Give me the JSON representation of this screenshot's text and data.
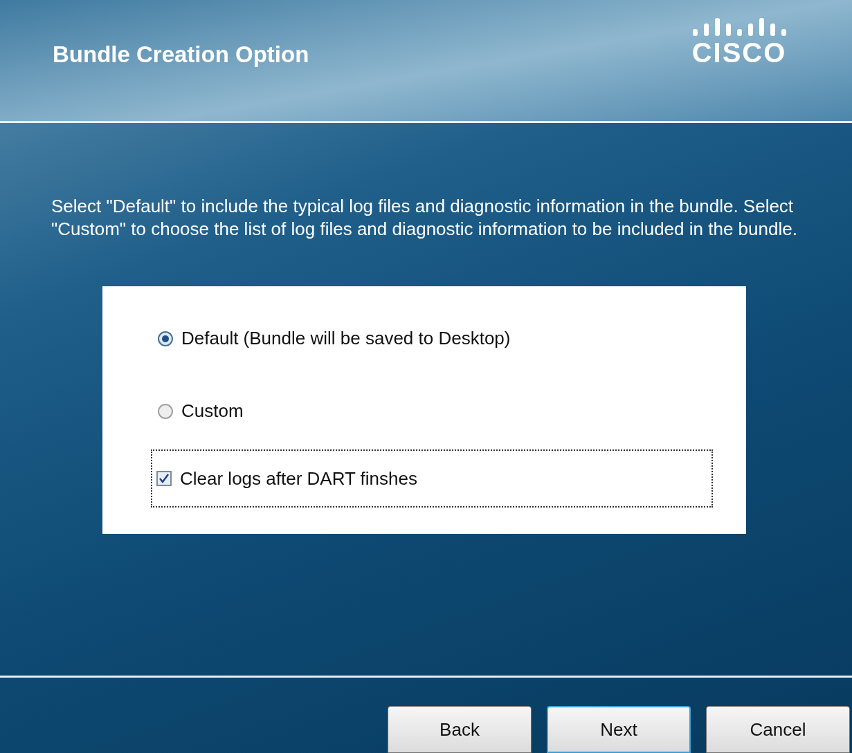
{
  "header": {
    "title": "Bundle Creation Option",
    "logo_text": "CISCO"
  },
  "description": "Select \"Default\" to include the typical log files and diagnostic information in the bundle.  Select \"Custom\" to choose the list of log files and diagnostic information to be included in the bundle.",
  "options": [
    {
      "label": "Default (Bundle will be saved to Desktop)",
      "selected": true
    },
    {
      "label": "Custom",
      "selected": false
    }
  ],
  "checkbox": {
    "label": "Clear logs after DART finshes",
    "checked": true,
    "focused": true
  },
  "buttons": [
    {
      "label": "Back",
      "default": false
    },
    {
      "label": "Next",
      "default": true
    },
    {
      "label": "Cancel",
      "default": false
    }
  ]
}
